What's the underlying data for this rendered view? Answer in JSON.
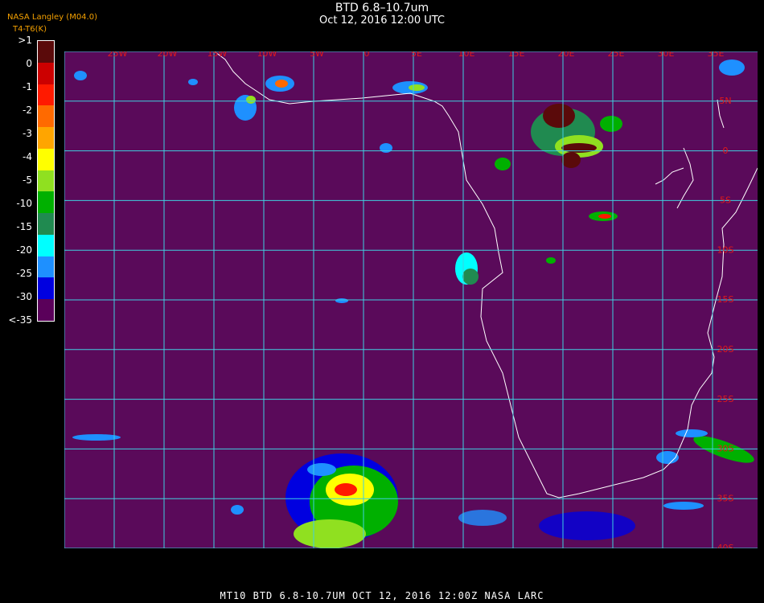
{
  "title": "BTD 6.8–10.7um",
  "subtitle": "Oct 12, 2016 12:00 UTC",
  "org_line1": "NASA Langley (M04.0)",
  "org_line2": "T4-T6(K)",
  "legend": {
    "labels": [
      ">1",
      "0",
      "-1",
      "-2",
      "-3",
      "-4",
      "-5",
      "-10",
      "-15",
      "-20",
      "-25",
      "-30",
      "<-35"
    ],
    "colors": [
      "#5a0a0a",
      "#cc0000",
      "#ff1a00",
      "#ff6a00",
      "#ffa500",
      "#ffff00",
      "#90e020",
      "#00b000",
      "#208a50",
      "#00ffff",
      "#1e90ff",
      "#0000e0",
      "#5a005a"
    ]
  },
  "longitude_labels": [
    "25W",
    "20W",
    "15W",
    "10W",
    "5W",
    "0",
    "5E",
    "10E",
    "15E",
    "20E",
    "25E",
    "30E",
    "35E"
  ],
  "latitude_labels": [
    "5N",
    "0",
    "5S",
    "10S",
    "15S",
    "20S",
    "25S",
    "30S",
    "35S",
    "40S"
  ],
  "footer": "MT10  BTD 6.8-10.7UM   OCT 12, 2016 12:00Z   NASA LARC",
  "colors": {
    "background": "#5a0a5a",
    "grid": "#3fd0e0",
    "coast": "#ffffff",
    "axis_label": "#e01a1a"
  }
}
